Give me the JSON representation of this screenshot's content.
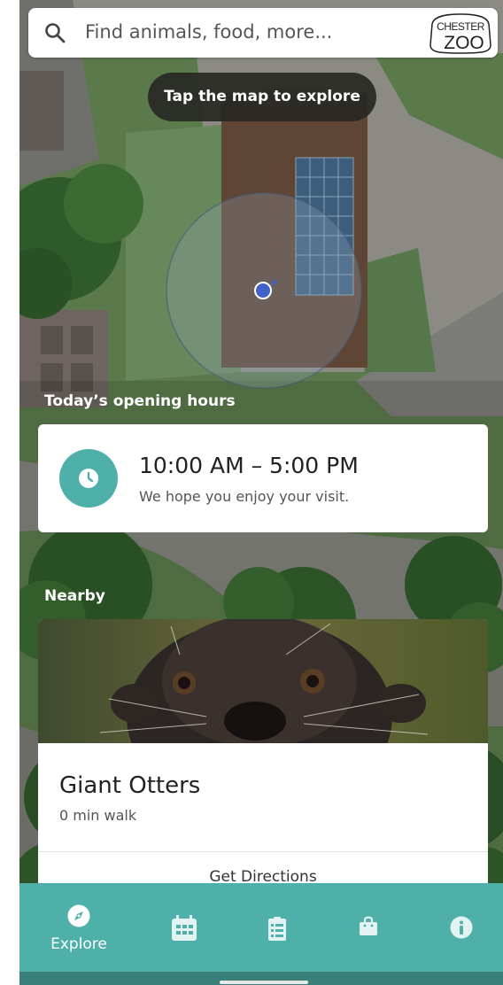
{
  "search": {
    "placeholder": "Find animals, food, more..."
  },
  "logo": {
    "line1": "CHESTER",
    "line2": "ZOO"
  },
  "map": {
    "hint": "Tap the map to explore"
  },
  "opening_hours": {
    "section_label": "Today’s opening hours",
    "time_range": "10:00 AM – 5:00 PM",
    "message": "We hope you enjoy your visit."
  },
  "nearby": {
    "section_label": "Nearby",
    "animal_name": "Giant Otters",
    "walk_time": "0 min walk",
    "directions_label": "Get Directions"
  },
  "bottom_nav": {
    "items": [
      {
        "label": "Explore",
        "icon": "compass-icon",
        "active": true
      },
      {
        "label": "",
        "icon": "calendar-icon",
        "active": false
      },
      {
        "label": "",
        "icon": "checklist-icon",
        "active": false
      },
      {
        "label": "",
        "icon": "shopping-bag-icon",
        "active": false
      },
      {
        "label": "",
        "icon": "info-icon",
        "active": false
      }
    ]
  },
  "colors": {
    "accent": "#4fb0a9",
    "map_grass": "#5a7a4a",
    "map_path": "#8a8a80",
    "building": "#5e4534",
    "card_bg": "#ffffff"
  }
}
